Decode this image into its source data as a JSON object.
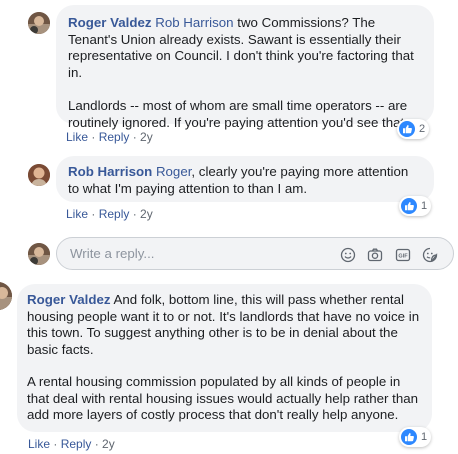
{
  "comments": [
    {
      "author": "Roger Valdez",
      "mention": "Rob Harrison",
      "p1_rest": " two Commissions? The Tenant's Union already exists. Sawant is essentially their representative on Council. I don't think you're factoring that in.",
      "p2": "Landlords -- most of whom are small time operators -- are routinely ignored. If you're paying attention you'd see that.",
      "like": "Like",
      "reply": "Reply",
      "age": "2y",
      "reactions": "2"
    },
    {
      "author": "Rob Harrison",
      "mention": "Roger",
      "p1_rest": ", clearly you're paying more attention to what I'm paying attention to than I am.",
      "like": "Like",
      "reply": "Reply",
      "age": "2y",
      "reactions": "1"
    },
    {
      "author": "Roger Valdez",
      "p1_rest": " And folk, bottom line, this will pass whether rental housing people want it to or not. It's landlords that have no voice in this town. To suggest anything other is to be in denial about the basic facts.",
      "p2": "A rental housing commission populated by all kinds of people in that deal with rental housing issues would actually help rather than add more layers of costly process that don't really help anyone.",
      "like": "Like",
      "reply": "Reply",
      "age": "2y",
      "reactions": "1"
    }
  ],
  "reply_box": {
    "placeholder": "Write a reply...",
    "icons": [
      "emoji-icon",
      "camera-icon",
      "gif-icon",
      "sticker-icon"
    ]
  },
  "colors": {
    "link": "#385898",
    "bubble": "#f2f3f5",
    "like_blue": "#2d88ff",
    "meta": "#606770"
  },
  "sep": " · "
}
